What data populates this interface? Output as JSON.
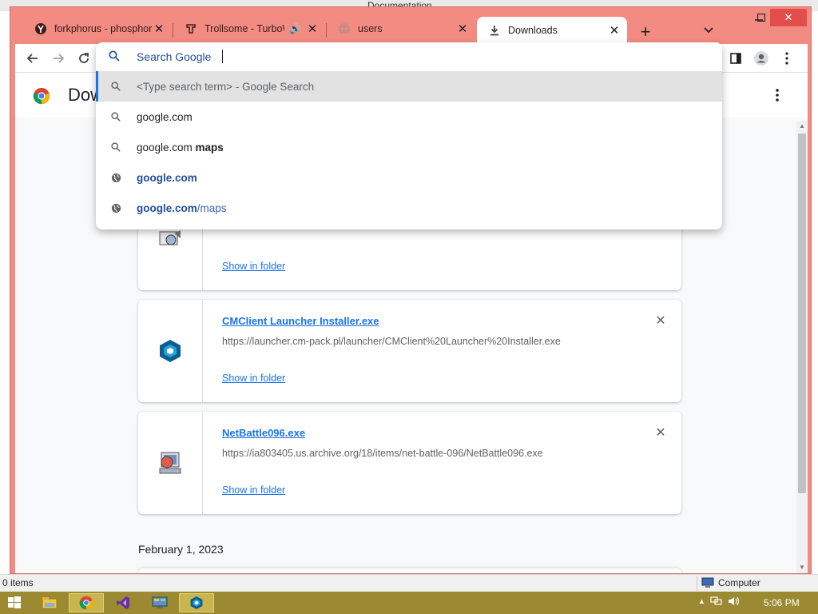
{
  "background_window": {
    "title": "Documentation",
    "status_items": "0 items",
    "status_computer": "Computer"
  },
  "browser": {
    "accent_color": "#f28b82",
    "tabs": [
      {
        "title": "forkphorus - phosphorus",
        "icon": "fork-favicon-icon",
        "muted": false
      },
      {
        "title": "Trollsome - TurboWarp",
        "icon": "turbowarp-favicon-icon",
        "audio": true
      },
      {
        "title": "users",
        "icon": "globe-icon"
      },
      {
        "title": "Downloads",
        "icon": "download-icon",
        "active": true
      }
    ],
    "omnibox": {
      "placeholder": "Search Google",
      "suggestions": [
        {
          "icon": "search-icon",
          "text": "<Type search term>",
          "suffix": " - Google Search",
          "highlighted": true
        },
        {
          "icon": "search-icon",
          "text": "google.com"
        },
        {
          "icon": "search-icon",
          "text": "google.com ",
          "bold": "maps"
        },
        {
          "icon": "globe-icon",
          "link": "google.com",
          "path": ""
        },
        {
          "icon": "globe-icon",
          "link": "google.com",
          "path": "/maps"
        }
      ]
    }
  },
  "downloads_page": {
    "title": "Downloads",
    "items": [
      {
        "name": "",
        "url": "",
        "action": "Show in folder"
      },
      {
        "name": "CMClient Launcher Installer.exe",
        "url": "https://launcher.cm-pack.pl/launcher/CMClient%20Launcher%20Installer.exe",
        "action": "Show in folder"
      },
      {
        "name": "NetBattle096.exe",
        "url": "https://ia803405.us.archive.org/18/items/net-battle-096/NetBattle096.exe",
        "action": "Show in folder"
      }
    ],
    "date_heading": "February 1, 2023"
  },
  "taskbar": {
    "clock": "5:06 PM",
    "apps": [
      "start-icon",
      "file-explorer-icon",
      "chrome-icon",
      "visual-studio-icon",
      "control-panel-icon",
      "cmclient-icon"
    ]
  }
}
